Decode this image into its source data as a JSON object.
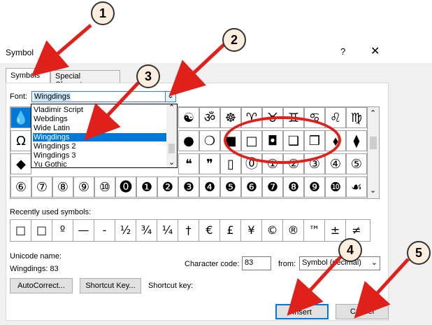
{
  "dialog": {
    "title": "Symbol",
    "help": "?",
    "close": "✕"
  },
  "tabs": [
    {
      "label": "Symbols"
    },
    {
      "label": "Special Characters"
    }
  ],
  "font": {
    "label": "Font:",
    "value": "Wingdings",
    "options": [
      "Vladimir Script",
      "Webdings",
      "Wide Latin",
      "Wingdings",
      "Wingdings 2",
      "Wingdings 3",
      "Yu Gothic"
    ],
    "selected": "Wingdings"
  },
  "symbols": {
    "row1": [
      "☯",
      "ॐ",
      "☸",
      "♈",
      "♉",
      "♊",
      "♋",
      "♌",
      "♍"
    ],
    "row2_left": [
      "●",
      "❍",
      "■",
      "□",
      "◘",
      "❑",
      "❒",
      "⬧",
      "⧫"
    ],
    "row3_left": [
      "❝",
      "❞",
      "▯",
      "⓪",
      "①",
      "②",
      "③",
      "④",
      "⑤"
    ],
    "row4": [
      "⑥",
      "⑦",
      "⑧",
      "⑨",
      "⑩",
      "⓿",
      "❶",
      "❷",
      "❸",
      "❹",
      "❺",
      "❻",
      "❼",
      "❽",
      "❾",
      "❿",
      "☙"
    ],
    "col1": [
      "💧",
      "Ω",
      "◆"
    ]
  },
  "recent": {
    "label": "Recently used symbols:",
    "items": [
      "□",
      "□",
      "º",
      "—",
      "-",
      "½",
      "¾",
      "¼",
      "†",
      "€",
      "£",
      "¥",
      "©",
      "®",
      "™",
      "±",
      "≠"
    ]
  },
  "unicode": {
    "label": "Unicode name:",
    "value": "Wingdings: 83"
  },
  "charcode": {
    "label": "Character code:",
    "value": "83",
    "from_label": "from:",
    "from_value": "Symbol (decimal)"
  },
  "buttons": {
    "autocorrect": "AutoCorrect...",
    "shortcut_key": "Shortcut Key...",
    "shortcut_label": "Shortcut key:",
    "insert": "Insert",
    "cancel": "Cancel"
  },
  "badges": [
    "1",
    "2",
    "3",
    "4",
    "5"
  ],
  "colors": {
    "accent": "#0078d7",
    "annotation": "#e0201b"
  }
}
